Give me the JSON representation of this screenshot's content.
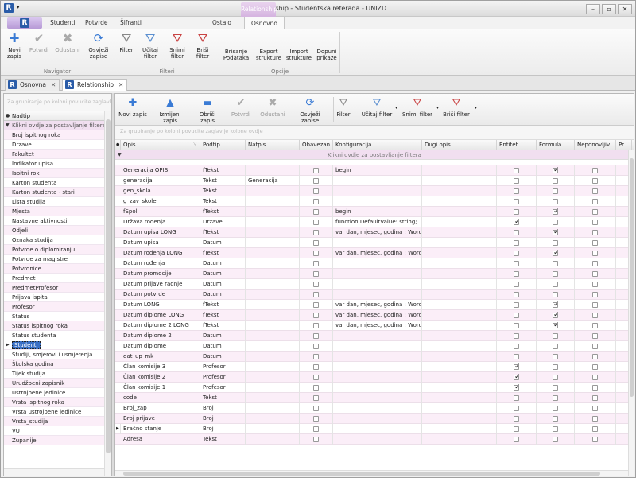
{
  "window": {
    "title": "Relationship - Studentska referada - UNIZD",
    "context_tab": "Relationship",
    "logo": "R"
  },
  "menu": {
    "tabs": [
      "Studenti",
      "Potvrde",
      "Šifranti",
      "Ostalo",
      "Osnovno"
    ],
    "selected": "Osnovno"
  },
  "ribbon": {
    "buttons": [
      {
        "label": "Novi\nzapis",
        "icon": "plus-icon"
      },
      {
        "label": "Potvrdi",
        "icon": "check-icon",
        "disabled": true
      },
      {
        "label": "Odustani",
        "icon": "x-icon",
        "disabled": true
      },
      {
        "label": "Osvježi\nzapise",
        "icon": "refresh-icon"
      },
      {
        "label": "Filter",
        "icon": "filter-icon"
      },
      {
        "label": "Učitaj\nfilter",
        "icon": "load-filter-icon"
      },
      {
        "label": "Snimi\nfilter",
        "icon": "save-filter-icon"
      },
      {
        "label": "Briši\nfilter",
        "icon": "delete-filter-icon"
      },
      {
        "label": "Brisanje\nPodataka"
      },
      {
        "label": "Export\nstrukture"
      },
      {
        "label": "Import\nstrukture"
      },
      {
        "label": "Dopuni\nprikaze"
      }
    ],
    "groups": [
      "Navigator",
      "Filteri",
      "Opcije"
    ]
  },
  "doc_tabs": [
    "Osnovna",
    "Relationship"
  ],
  "left_panel": {
    "group_hint": "Za grupiranje po koloni povucite zaglavlje",
    "header": "Nadtip",
    "filter_row": "Klikni ovdje za postavljanje filtera",
    "items": [
      "Broj ispitnog roka",
      "Drzave",
      "Fakultet",
      "Indikator upisa",
      "Ispitni rok",
      "Karton studenta",
      "Karton studenta - stari",
      "Lista studija",
      "Mjesta",
      "Nastavne aktivnosti",
      "Odjeli",
      "Oznaka studija",
      "Potvrde o diplomiranju",
      "Potvrde za magistre",
      "Potvrdnice",
      "Predmet",
      "PredmetProfesor",
      "Prijava ispita",
      "Profesor",
      "Status",
      "Status ispitnog roka",
      "Status studenta",
      "Studenti",
      "Studiji, smjerovi i usmjerenja",
      "Školska godina",
      "Tijek studija",
      "Urudžbeni zapisnik",
      "Ustrojbene jedinice",
      "Vrsta ispitnog roka",
      "Vrsta ustrojbene jedinice",
      "Vrsta_studija",
      "VU",
      "Županije"
    ],
    "selected": "Studenti"
  },
  "grid_toolbar": {
    "buttons": [
      {
        "label": "Novi zapis",
        "icon": "plus-icon"
      },
      {
        "label": "Izmijeni zapis",
        "icon": "edit-icon"
      },
      {
        "label": "Obriši zapis",
        "icon": "minus-icon"
      },
      {
        "label": "Potvrdi",
        "icon": "check-icon",
        "disabled": true
      },
      {
        "label": "Odustani",
        "icon": "x-icon",
        "disabled": true
      },
      {
        "label": "Osvježi zapise",
        "icon": "refresh-icon"
      },
      {
        "label": "Filter",
        "icon": "filter-icon"
      },
      {
        "label": "Učitaj filter",
        "icon": "load-filter-icon"
      },
      {
        "label": "Snimi filter",
        "icon": "save-filter-icon"
      },
      {
        "label": "Briši filter",
        "icon": "delete-filter-icon"
      }
    ]
  },
  "grid": {
    "group_hint": "Za grupiranje po koloni povucite zaglavlje kolone ovdje",
    "filter_row": "Klikni ovdje za postavljanje filtera",
    "columns": [
      "Opis",
      "Podtip",
      "Natpis",
      "Obavezan",
      "Konfiguracija",
      "Dugi opis",
      "Entitet",
      "Formula",
      "Neponovljiv",
      "Pr"
    ],
    "rows": [
      {
        "opis": "Generacija OPIS",
        "podtip": "fTekst",
        "natpis": "",
        "konf": "begin",
        "obavezan": false,
        "entitet": false,
        "formula": true,
        "nep": false
      },
      {
        "opis": "generacija",
        "podtip": "Tekst",
        "natpis": "Generacija",
        "konf": "",
        "obavezan": false,
        "entitet": false,
        "formula": false,
        "nep": false
      },
      {
        "opis": "gen_skola",
        "podtip": "Tekst",
        "natpis": "",
        "konf": "",
        "obavezan": false,
        "entitet": false,
        "formula": false,
        "nep": false
      },
      {
        "opis": "g_zav_skole",
        "podtip": "Tekst",
        "natpis": "",
        "konf": "",
        "obavezan": false,
        "entitet": false,
        "formula": false,
        "nep": false
      },
      {
        "opis": "fSpol",
        "podtip": "fTekst",
        "natpis": "",
        "konf": "begin",
        "obavezan": false,
        "entitet": false,
        "formula": true,
        "nep": false
      },
      {
        "opis": "Država rođenja",
        "podtip": "Drzave",
        "natpis": "",
        "konf": "function DefaultValue: string;",
        "obavezan": false,
        "entitet": true,
        "formula": false,
        "nep": false
      },
      {
        "opis": "Datum upisa LONG",
        "podtip": "fTekst",
        "natpis": "",
        "konf": "var dan, mjesec, godina : Word;",
        "obavezan": false,
        "entitet": false,
        "formula": true,
        "nep": false
      },
      {
        "opis": "Datum upisa",
        "podtip": "Datum",
        "natpis": "",
        "konf": "",
        "obavezan": false,
        "entitet": false,
        "formula": false,
        "nep": false
      },
      {
        "opis": "Datum rođenja LONG",
        "podtip": "fTekst",
        "natpis": "",
        "konf": "var dan, mjesec, godina : Word;",
        "obavezan": false,
        "entitet": false,
        "formula": true,
        "nep": false
      },
      {
        "opis": "Datum rođenja",
        "podtip": "Datum",
        "natpis": "",
        "konf": "",
        "obavezan": false,
        "entitet": false,
        "formula": false,
        "nep": false
      },
      {
        "opis": "Datum promocije",
        "podtip": "Datum",
        "natpis": "",
        "konf": "",
        "obavezan": false,
        "entitet": false,
        "formula": false,
        "nep": false
      },
      {
        "opis": "Datum prijave radnje",
        "podtip": "Datum",
        "natpis": "",
        "konf": "",
        "obavezan": false,
        "entitet": false,
        "formula": false,
        "nep": false
      },
      {
        "opis": "Datum potvrde",
        "podtip": "Datum",
        "natpis": "",
        "konf": "",
        "obavezan": false,
        "entitet": false,
        "formula": false,
        "nep": false
      },
      {
        "opis": "Datum LONG",
        "podtip": "fTekst",
        "natpis": "",
        "konf": "var dan, mjesec, godina : Word;",
        "obavezan": false,
        "entitet": false,
        "formula": true,
        "nep": false
      },
      {
        "opis": "Datum diplome LONG",
        "podtip": "fTekst",
        "natpis": "",
        "konf": "var dan, mjesec, godina : Word;",
        "obavezan": false,
        "entitet": false,
        "formula": true,
        "nep": false
      },
      {
        "opis": "Datum diplome 2 LONG",
        "podtip": "fTekst",
        "natpis": "",
        "konf": "var dan, mjesec, godina : Word;",
        "obavezan": false,
        "entitet": false,
        "formula": true,
        "nep": false
      },
      {
        "opis": "Datum diplome 2",
        "podtip": "Datum",
        "natpis": "",
        "konf": "",
        "obavezan": false,
        "entitet": false,
        "formula": false,
        "nep": false
      },
      {
        "opis": "Datum diplome",
        "podtip": "Datum",
        "natpis": "",
        "konf": "",
        "obavezan": false,
        "entitet": false,
        "formula": false,
        "nep": false
      },
      {
        "opis": "dat_up_mk",
        "podtip": "Datum",
        "natpis": "",
        "konf": "",
        "obavezan": false,
        "entitet": false,
        "formula": false,
        "nep": false
      },
      {
        "opis": "Član komisije 3",
        "podtip": "Profesor",
        "natpis": "",
        "konf": "",
        "obavezan": false,
        "entitet": true,
        "formula": false,
        "nep": false
      },
      {
        "opis": "Član komisije 2",
        "podtip": "Profesor",
        "natpis": "",
        "konf": "",
        "obavezan": false,
        "entitet": true,
        "formula": false,
        "nep": false
      },
      {
        "opis": "Član komisije 1",
        "podtip": "Profesor",
        "natpis": "",
        "konf": "",
        "obavezan": false,
        "entitet": true,
        "formula": false,
        "nep": false
      },
      {
        "opis": "code",
        "podtip": "Tekst",
        "natpis": "",
        "konf": "",
        "obavezan": false,
        "entitet": false,
        "formula": false,
        "nep": false
      },
      {
        "opis": "Broj_zap",
        "podtip": "Broj",
        "natpis": "",
        "konf": "",
        "obavezan": false,
        "entitet": false,
        "formula": false,
        "nep": false
      },
      {
        "opis": "Broj prijave",
        "podtip": "Broj",
        "natpis": "",
        "konf": "",
        "obavezan": false,
        "entitet": false,
        "formula": false,
        "nep": false
      },
      {
        "opis": "Bračno stanje",
        "podtip": "Broj",
        "natpis": "",
        "konf": "",
        "obavezan": false,
        "entitet": false,
        "formula": false,
        "nep": false
      },
      {
        "opis": "Adresa",
        "podtip": "Tekst",
        "natpis": "",
        "konf": "",
        "obavezan": false,
        "entitet": false,
        "formula": false,
        "nep": false
      }
    ],
    "current_row": "Bračno stanje"
  }
}
